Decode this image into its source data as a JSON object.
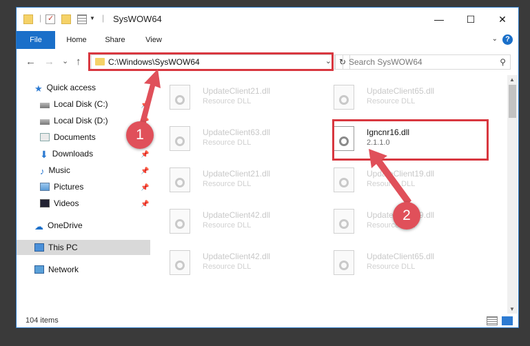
{
  "window": {
    "title": "SysWOW64",
    "controls": {
      "minimize": "—",
      "maximize": "☐",
      "close": "✕"
    }
  },
  "ribbon": {
    "tabs": [
      "File",
      "Home",
      "Share",
      "View"
    ],
    "help": "?"
  },
  "navigation": {
    "back": "←",
    "forward": "→",
    "recent": "⌄",
    "up": "↑",
    "address": "C:\\Windows\\SysWOW64",
    "search_placeholder": "Search SysWOW64"
  },
  "sidebar": {
    "items": [
      {
        "label": "Quick access",
        "icon": "star-icon",
        "pinned": false
      },
      {
        "label": "Local Disk (C:)",
        "icon": "drive-icon",
        "pinned": true
      },
      {
        "label": "Local Disk (D:)",
        "icon": "drive-icon",
        "pinned": true
      },
      {
        "label": "Documents",
        "icon": "documents-icon",
        "pinned": true
      },
      {
        "label": "Downloads",
        "icon": "download-icon",
        "pinned": true
      },
      {
        "label": "Music",
        "icon": "music-icon",
        "pinned": true
      },
      {
        "label": "Pictures",
        "icon": "pictures-icon",
        "pinned": true
      },
      {
        "label": "Videos",
        "icon": "videos-icon",
        "pinned": true
      },
      {
        "label": "OneDrive",
        "icon": "cloud-icon",
        "pinned": false
      },
      {
        "label": "This PC",
        "icon": "computer-icon",
        "pinned": false,
        "selected": true
      },
      {
        "label": "Network",
        "icon": "network-icon",
        "pinned": false
      }
    ]
  },
  "files": [
    {
      "name": "UpdateClient21.dll",
      "type": "Resource DLL"
    },
    {
      "name": "UpdateClient65.dll",
      "type": "Resource DLL"
    },
    {
      "name": "UpdateClient63.dll",
      "type": "Resource DLL"
    },
    {
      "name": "Igncnr16.dll",
      "type": "2.1.1.0",
      "highlighted": true
    },
    {
      "name": "UpdateClient21.dll",
      "type": "Resource DLL"
    },
    {
      "name": "UpdateClient19.dll",
      "type": "Resource DLL"
    },
    {
      "name": "UpdateClient42.dll",
      "type": "Resource DLL"
    },
    {
      "name": "UpdateClient19.dll",
      "type": "Resource DLL"
    },
    {
      "name": "UpdateClient42.dll",
      "type": "Resource DLL"
    },
    {
      "name": "UpdateClient65.dll",
      "type": "Resource DLL"
    }
  ],
  "status": {
    "item_count": "104 items"
  },
  "annotations": {
    "step1": "1",
    "step2": "2",
    "highlight_color": "#d8373f"
  }
}
